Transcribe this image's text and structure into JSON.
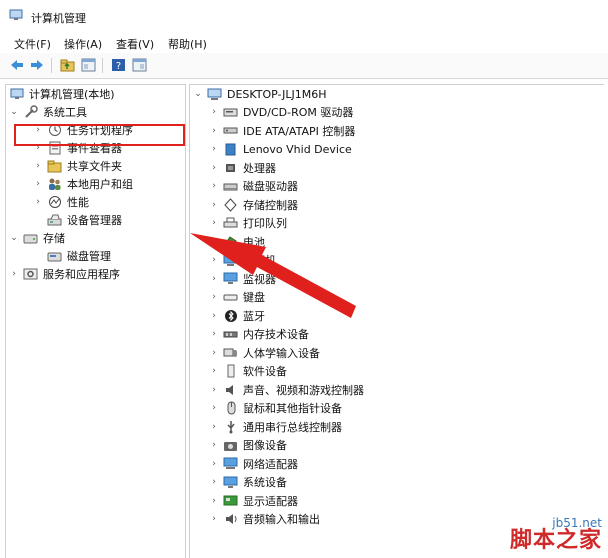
{
  "window": {
    "title": "计算机管理"
  },
  "menu": [
    {
      "label": "文件(F)"
    },
    {
      "label": "操作(A)"
    },
    {
      "label": "查看(V)"
    },
    {
      "label": "帮助(H)"
    }
  ],
  "toolbar": {
    "icons": [
      "back-arrow-icon",
      "forward-arrow-icon",
      "up-folder-icon",
      "console-tree-icon",
      "help-icon",
      "properties-icon"
    ]
  },
  "left_tree": {
    "root": "计算机管理(本地)",
    "items": [
      {
        "label": "系统工具",
        "expanded": true
      },
      {
        "label": "任务计划程序"
      },
      {
        "label": "事件查看器"
      },
      {
        "label": "共享文件夹"
      },
      {
        "label": "本地用户和组"
      },
      {
        "label": "性能"
      },
      {
        "label": "设备管理器",
        "selected": true
      },
      {
        "label": "存储",
        "expanded": true
      },
      {
        "label": "磁盘管理"
      },
      {
        "label": "服务和应用程序"
      }
    ]
  },
  "device_tree": {
    "root": "DESKTOP-JLJ1M6H",
    "categories": [
      {
        "label": "DVD/CD-ROM 驱动器",
        "icon": "dvd-drive-icon"
      },
      {
        "label": "IDE ATA/ATAPI 控制器",
        "icon": "ide-controller-icon"
      },
      {
        "label": "Lenovo Vhid Device",
        "icon": "lenovo-device-icon"
      },
      {
        "label": "处理器",
        "icon": "processor-icon"
      },
      {
        "label": "磁盘驱动器",
        "icon": "disk-drive-icon"
      },
      {
        "label": "存储控制器",
        "icon": "storage-controller-icon"
      },
      {
        "label": "打印队列",
        "icon": "printer-icon"
      },
      {
        "label": "电池",
        "icon": "battery-icon"
      },
      {
        "label": "计算机",
        "icon": "computer-icon"
      },
      {
        "label": "监视器",
        "icon": "monitor-icon"
      },
      {
        "label": "键盘",
        "icon": "keyboard-icon"
      },
      {
        "label": "蓝牙",
        "icon": "bluetooth-icon"
      },
      {
        "label": "内存技术设备",
        "icon": "memory-device-icon"
      },
      {
        "label": "人体学输入设备",
        "icon": "hid-icon"
      },
      {
        "label": "软件设备",
        "icon": "software-device-icon"
      },
      {
        "label": "声音、视频和游戏控制器",
        "icon": "sound-icon"
      },
      {
        "label": "鼠标和其他指针设备",
        "icon": "mouse-icon"
      },
      {
        "label": "通用串行总线控制器",
        "icon": "usb-icon"
      },
      {
        "label": "图像设备",
        "icon": "camera-icon"
      },
      {
        "label": "网络适配器",
        "icon": "network-adapter-icon"
      },
      {
        "label": "系统设备",
        "icon": "system-device-icon"
      },
      {
        "label": "显示适配器",
        "icon": "display-adapter-icon"
      },
      {
        "label": "音频输入和输出",
        "icon": "audio-io-icon"
      }
    ]
  },
  "annotation": {
    "color": "#e0201c"
  },
  "watermark": {
    "site": "jb51.net",
    "brand": "脚本之家"
  }
}
